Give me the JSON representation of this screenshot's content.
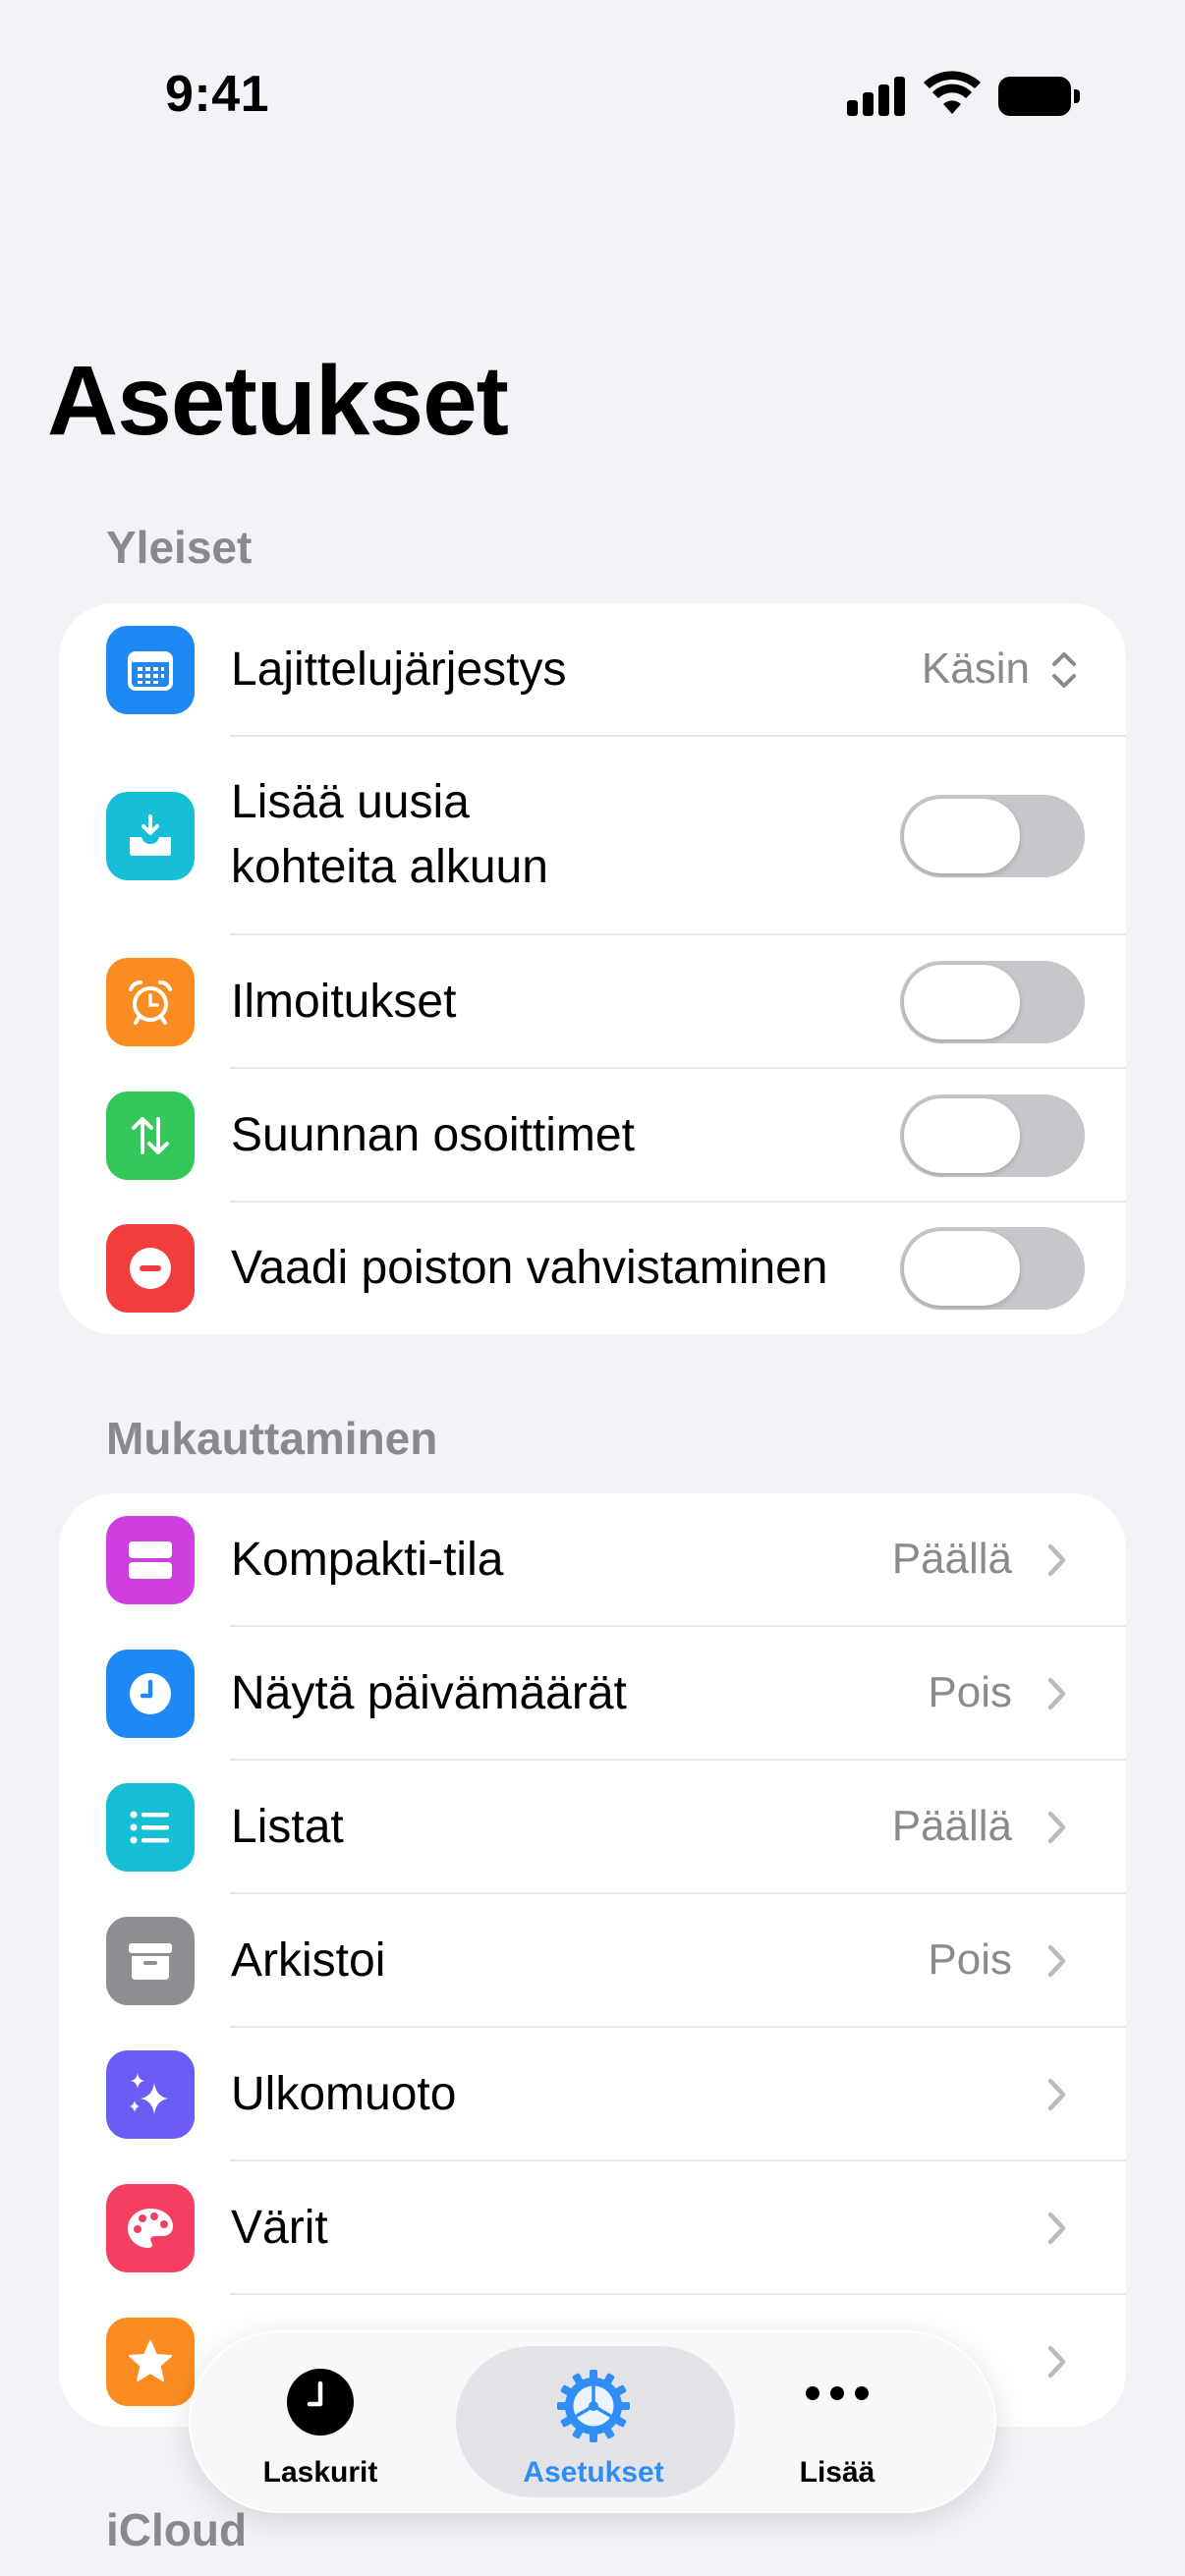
{
  "status_bar": {
    "time": "9:41"
  },
  "page_title": "Asetukset",
  "sections": {
    "general": {
      "header": "Yleiset",
      "rows": [
        {
          "label": "Lajittelujärjestys",
          "value": "Käsin",
          "icon": "calendar-grid-icon",
          "color": "#1e88f5"
        },
        {
          "label": "Lisää uusia",
          "label2": "kohteita alkuun",
          "toggle": false,
          "icon": "tray-download-icon",
          "color": "#16bfd6"
        },
        {
          "label": "Ilmoitukset",
          "toggle": false,
          "icon": "alarm-clock-icon",
          "color": "#fb8c21"
        },
        {
          "label": "Suunnan osoittimet",
          "toggle": false,
          "icon": "up-down-arrows-icon",
          "color": "#34c759"
        },
        {
          "label": "Vaadi poiston vahvistaminen",
          "toggle": false,
          "icon": "minus-circle-icon",
          "color": "#f23d3d"
        }
      ]
    },
    "customization": {
      "header": "Mukauttaminen",
      "rows": [
        {
          "label": "Kompakti-tila",
          "value": "Päällä",
          "icon": "compact-rows-icon",
          "color": "#cf3fe0"
        },
        {
          "label": "Näytä päivämäärät",
          "value": "Pois",
          "icon": "clock-icon",
          "color": "#1e88f5"
        },
        {
          "label": "Listat",
          "value": "Päällä",
          "icon": "list-icon",
          "color": "#16bfd6"
        },
        {
          "label": "Arkistoi",
          "value": "Pois",
          "icon": "archive-box-icon",
          "color": "#8e8e93"
        },
        {
          "label": "Ulkomuoto",
          "value": "",
          "icon": "sparkles-icon",
          "color": "#6a5cf5"
        },
        {
          "label": "Värit",
          "value": "",
          "icon": "palette-icon",
          "color": "#f43f61"
        },
        {
          "label": "",
          "value": "",
          "icon": "star-icon",
          "color": "#fb8c21"
        }
      ]
    },
    "icloud": {
      "header": "iCloud"
    }
  },
  "tabbar": {
    "tabs": [
      {
        "label": "Laskurit",
        "icon": "clock-filled-icon",
        "active": false
      },
      {
        "label": "Asetukset",
        "icon": "gear-icon",
        "active": true
      },
      {
        "label": "Lisää",
        "icon": "ellipsis-icon",
        "active": false
      }
    ],
    "active_color": "#2f8ef5"
  }
}
